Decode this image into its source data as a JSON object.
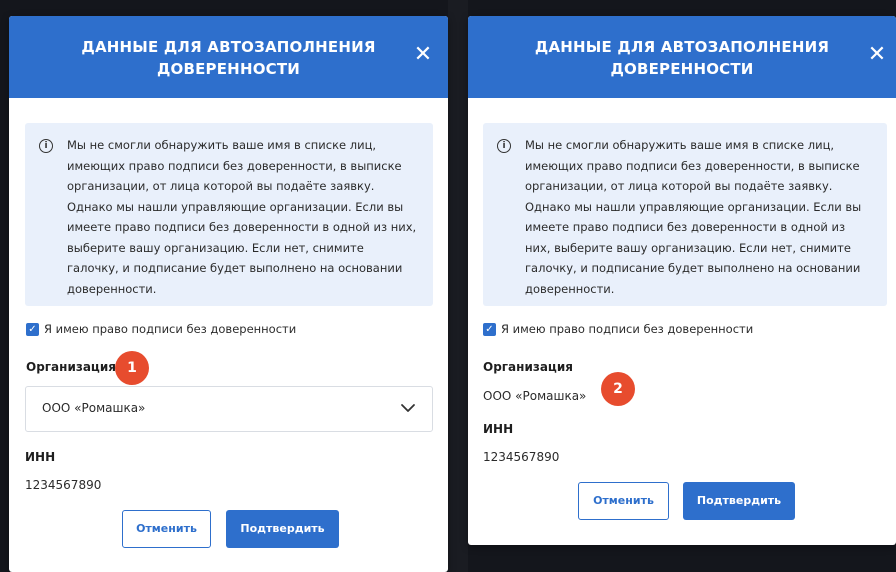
{
  "colors": {
    "header_blue": "#2e6fcc",
    "info_bg": "#e9f0fb",
    "badge_red": "#e74c2e",
    "backdrop": "#14161c"
  },
  "dialogs": [
    {
      "title": "ДАННЫЕ ДЛЯ АВТОЗАПОЛНЕНИЯ ДОВЕРЕННОСТИ",
      "close_icon": "close-icon",
      "info_text": "Мы не смогли обнаружить ваше имя в списке лиц, имеющих право подписи без доверенности, в выписке организации, от лица которой вы подаёте заявку. Однако мы нашли управляющие организации. Если вы имеете право подписи без доверенности в одной из них, выберите вашу организацию. Если нет, снимите галочку, и подписание будет выполнено на основании доверенности.",
      "checkbox_label": "Я имею право подписи без доверенности",
      "checkbox_checked": true,
      "org_label": "Организация",
      "org_value": "ООО «Ромашка»",
      "inn_label": "ИНН",
      "inn_value": "1234567890",
      "cancel_label": "Отменить",
      "confirm_label": "Подтвердить",
      "badge": "1"
    },
    {
      "title": "ДАННЫЕ ДЛЯ АВТОЗАПОЛНЕНИЯ ДОВЕРЕННОСТИ",
      "close_icon": "close-icon",
      "info_text": "Мы не смогли обнаружить ваше имя в списке лиц, имеющих право подписи без доверенности, в выписке организации, от лица которой вы подаёте заявку. Однако мы нашли управляющие организации. Если вы имеете право подписи без доверенности в одной из них, выберите вашу организацию. Если нет, снимите галочку, и подписание будет выполнено на основании доверенности.",
      "checkbox_label": "Я имею право подписи без доверенности",
      "checkbox_checked": true,
      "org_label": "Организация",
      "org_value": "ООО «Ромашка»",
      "inn_label": "ИНН",
      "inn_value": "1234567890",
      "cancel_label": "Отменить",
      "confirm_label": "Подтвердить",
      "badge": "2"
    }
  ]
}
